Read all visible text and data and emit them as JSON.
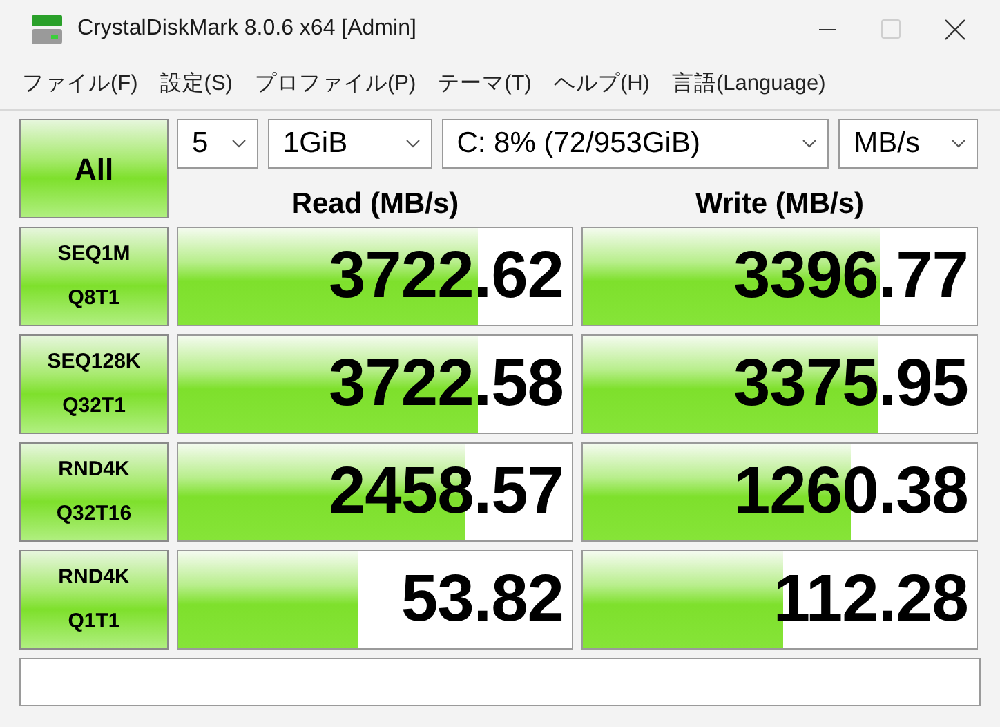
{
  "window": {
    "title": "CrystalDiskMark 8.0.6 x64 [Admin]",
    "maximize_disabled": true
  },
  "menu": [
    "ファイル(F)",
    "設定(S)",
    "プロファイル(P)",
    "テーマ(T)",
    "ヘルプ(H)",
    "言語(Language)"
  ],
  "all_button": "All",
  "selectors": [
    {
      "value": "5"
    },
    {
      "value": "1GiB"
    },
    {
      "value": "C: 8% (72/953GiB)"
    },
    {
      "value": "MB/s"
    }
  ],
  "columns": [
    "Read (MB/s)",
    "Write (MB/s)"
  ],
  "tests": [
    {
      "label": [
        "SEQ1M",
        "Q8T1"
      ],
      "read": {
        "value": "3722.62",
        "level": 0.76
      },
      "write": {
        "value": "3396.77",
        "level": 0.755
      }
    },
    {
      "label": [
        "SEQ128K",
        "Q32T1"
      ],
      "read": {
        "value": "3722.58",
        "level": 0.76
      },
      "write": {
        "value": "3375.95",
        "level": 0.752
      }
    },
    {
      "label": [
        "RND4K",
        "Q32T16"
      ],
      "read": {
        "value": "2458.57",
        "level": 0.73
      },
      "write": {
        "value": "1260.38",
        "level": 0.68
      }
    },
    {
      "label": [
        "RND4K",
        "Q1T1"
      ],
      "read": {
        "value": "53.82",
        "level": 0.455
      },
      "write": {
        "value": "112.28",
        "level": 0.51
      }
    }
  ]
}
